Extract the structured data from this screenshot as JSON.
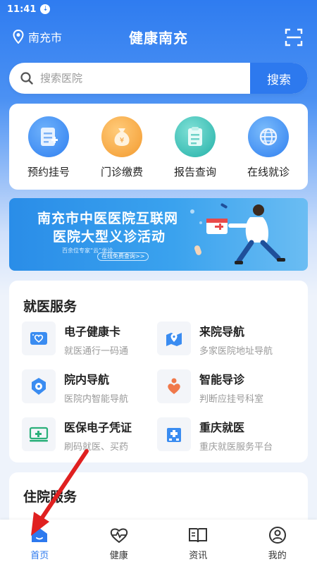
{
  "status_bar": {
    "time": "11:41",
    "badge": "⇣"
  },
  "header": {
    "location": "南充市",
    "title": "健康南充"
  },
  "search": {
    "placeholder": "搜索医院",
    "button_label": "搜索"
  },
  "quick_actions": [
    {
      "label": "预约挂号",
      "icon": "registration-icon",
      "color": "#3a8cf1"
    },
    {
      "label": "门诊缴费",
      "icon": "money-bag-icon",
      "color": "#f3a23b"
    },
    {
      "label": "报告查询",
      "icon": "report-icon",
      "color": "#2bb8b0"
    },
    {
      "label": "在线就诊",
      "icon": "globe-icon",
      "color": "#3a8cf1"
    }
  ],
  "banner": {
    "line1": "南充市中医医院互联网",
    "line2": "医院大型义诊活动",
    "subtitle": "百余位专家“云”坐诊",
    "link": "在线免费查询>>"
  },
  "medical_services": {
    "title": "就医服务",
    "items": [
      {
        "name": "电子健康卡",
        "desc": "就医通行一码通",
        "icon": "health-card-icon"
      },
      {
        "name": "来院导航",
        "desc": "多家医院地址导航",
        "icon": "map-navigation-icon"
      },
      {
        "name": "院内导航",
        "desc": "医院内智能导航",
        "icon": "hospital-location-icon"
      },
      {
        "name": "智能导诊",
        "desc": "判断应挂号科室",
        "icon": "smart-triage-icon"
      },
      {
        "name": "医保电子凭证",
        "desc": "刷码就医、买药",
        "icon": "insurance-card-icon"
      },
      {
        "name": "重庆就医",
        "desc": "重庆就医服务平台",
        "icon": "hospital-building-icon"
      }
    ]
  },
  "inpatient_services": {
    "title": "住院服务"
  },
  "tabbar": [
    {
      "label": "首页",
      "icon": "home-icon",
      "active": true
    },
    {
      "label": "健康",
      "icon": "heart-pulse-icon",
      "active": false
    },
    {
      "label": "资讯",
      "icon": "book-icon",
      "active": false
    },
    {
      "label": "我的",
      "icon": "user-icon",
      "active": false
    }
  ],
  "colors": {
    "accent": "#2d79ee",
    "header_blue": "#2f7cf0",
    "arrow_red": "#e02020"
  }
}
